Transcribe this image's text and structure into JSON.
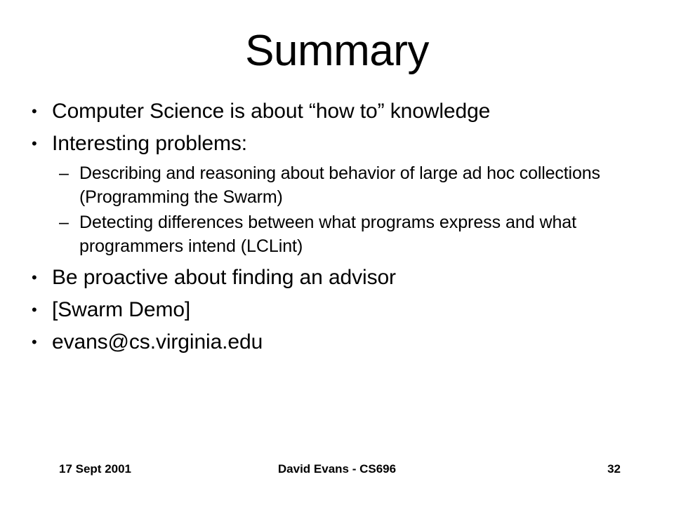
{
  "slide": {
    "title": "Summary",
    "bullets": [
      {
        "level": 1,
        "marker": "•",
        "text": "Computer Science is about “how to” knowledge"
      },
      {
        "level": 1,
        "marker": "•",
        "text": "Interesting problems:"
      },
      {
        "level": 2,
        "marker": "–",
        "text": "Describing and reasoning about behavior of large ad hoc collections (Programming the Swarm)"
      },
      {
        "level": 2,
        "marker": "–",
        "text": "Detecting differences between what programs express and what programmers intend (LCLint)"
      },
      {
        "level": 1,
        "marker": "•",
        "text": "Be proactive about finding an advisor"
      },
      {
        "level": 1,
        "marker": "•",
        "text": "[Swarm Demo]"
      },
      {
        "level": 1,
        "marker": "•",
        "text": "evans@cs.virginia.edu"
      }
    ],
    "footer": {
      "date": "17 Sept 2001",
      "center": "David Evans - CS696",
      "page_number": "32"
    },
    "colors": {
      "background": "#ffffff",
      "text": "#000000"
    }
  }
}
